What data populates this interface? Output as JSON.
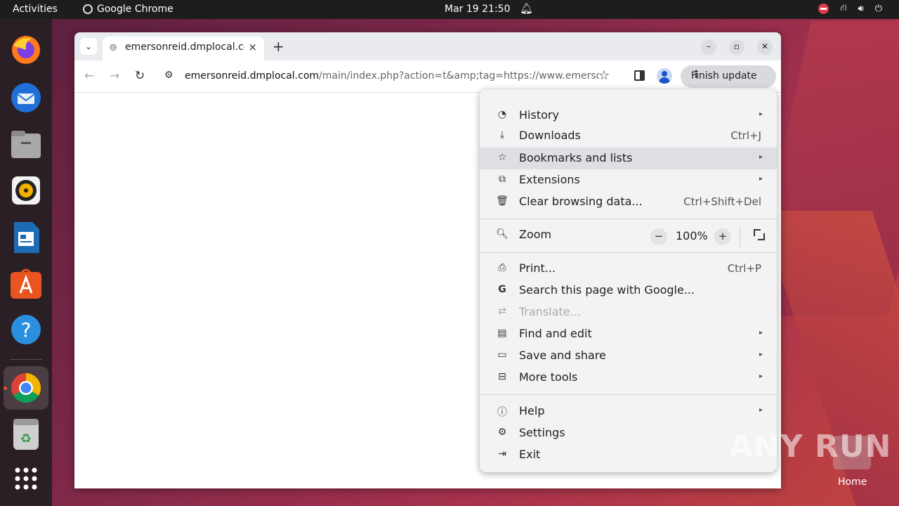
{
  "topbar": {
    "activities": "Activities",
    "app_name": "Google Chrome",
    "clock": "Mar 19  21:50"
  },
  "dock": {
    "items": [
      "firefox-icon",
      "thunderbird-icon",
      "files-icon",
      "rhythmbox-icon",
      "libreoffice-writer-icon",
      "app-center-icon",
      "help-icon",
      "chrome-icon",
      "trash-icon",
      "app-grid-icon"
    ]
  },
  "browser": {
    "tab_title": "emersonreid.dmplocal.com",
    "url_host": "emersonreid.dmplocal.com",
    "url_path": "/main/index.php?action=t&amp;tag=https://www.emersonreid....",
    "finish_update": "Finish update"
  },
  "menu": {
    "items": [
      {
        "label": "History",
        "shortcut": "",
        "icon": "history-icon",
        "submenu": true
      },
      {
        "label": "Downloads",
        "shortcut": "Ctrl+J",
        "icon": "download-icon",
        "submenu": false
      },
      {
        "label": "Bookmarks and lists",
        "shortcut": "",
        "icon": "star-icon",
        "submenu": true
      },
      {
        "label": "Extensions",
        "shortcut": "",
        "icon": "extension-icon",
        "submenu": true
      },
      {
        "label": "Clear browsing data...",
        "shortcut": "Ctrl+Shift+Del",
        "icon": "trash-icon",
        "submenu": false
      },
      {
        "label": "Zoom",
        "icon": "zoom-icon"
      },
      {
        "label": "Print...",
        "shortcut": "Ctrl+P",
        "icon": "print-icon",
        "submenu": false
      },
      {
        "label": "Search this page with Google...",
        "shortcut": "",
        "icon": "google-icon",
        "submenu": false
      },
      {
        "label": "Translate...",
        "shortcut": "",
        "icon": "translate-icon",
        "submenu": false
      },
      {
        "label": "Find and edit",
        "shortcut": "",
        "icon": "find-icon",
        "submenu": true
      },
      {
        "label": "Save and share",
        "shortcut": "",
        "icon": "save-icon",
        "submenu": true
      },
      {
        "label": "More tools",
        "shortcut": "",
        "icon": "toolbox-icon",
        "submenu": true
      },
      {
        "label": "Help",
        "shortcut": "",
        "icon": "help-icon",
        "submenu": true
      },
      {
        "label": "Settings",
        "shortcut": "",
        "icon": "settings-icon",
        "submenu": false
      },
      {
        "label": "Exit",
        "shortcut": "",
        "icon": "exit-icon",
        "submenu": false
      }
    ],
    "zoom": {
      "minus": "−",
      "value": "100%",
      "plus": "+"
    }
  },
  "desktop": {
    "home_label": "Home",
    "watermark": "ANY RUN"
  }
}
